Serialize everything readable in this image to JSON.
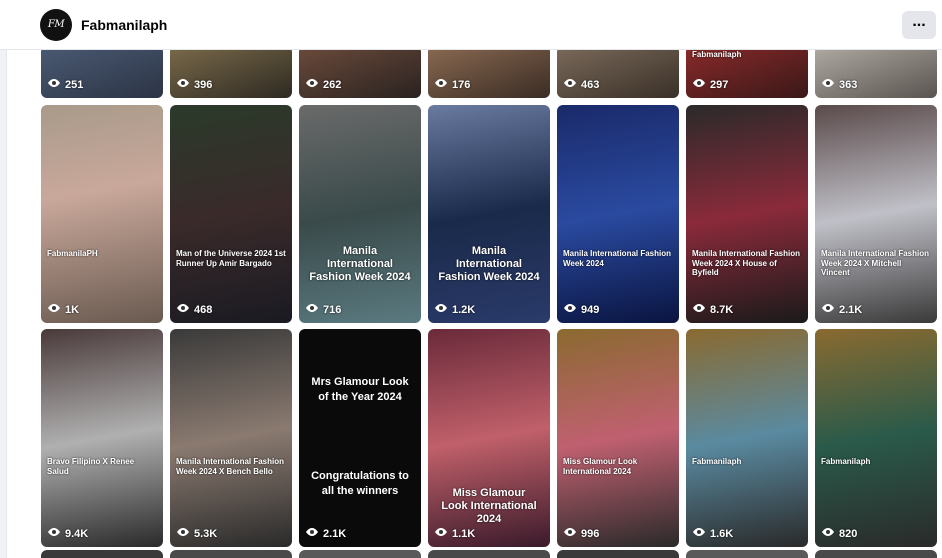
{
  "header": {
    "page_name": "Fabmanilaph",
    "avatar_text": "FM",
    "more_label": "..."
  },
  "rows": [
    [
      {
        "views": "251",
        "bg": "linear-gradient(160deg,#4a5a73,#2c3445)"
      },
      {
        "views": "396",
        "bg": "linear-gradient(160deg,#7a6a4a,#2e2a22)"
      },
      {
        "views": "262",
        "bg": "linear-gradient(160deg,#6b4b3b,#2a2220)"
      },
      {
        "views": "176",
        "bg": "linear-gradient(160deg,#8a6a52,#3a2c24)"
      },
      {
        "views": "463",
        "bg": "linear-gradient(160deg,#7a6a5a,#3a3028)"
      },
      {
        "views": "297",
        "caption": "Fabmanilaph",
        "bg": "linear-gradient(160deg,#8a2a2a,#3a1818)"
      },
      {
        "views": "363",
        "bg": "linear-gradient(160deg,#b0aaa4,#5a5450)"
      }
    ],
    [
      {
        "views": "1K",
        "caption": "FabmanilaPH",
        "bg": "linear-gradient(170deg,#a89a8a,#c9a89b 40%,#6a5a50)"
      },
      {
        "views": "468",
        "caption": "Man of the Universe 2024 1st Runner Up Amir Bargado",
        "bg": "linear-gradient(170deg,#2a3a2a,#3a2a2a 50%,#1a1a22)"
      },
      {
        "views": "716",
        "caption": "Manila International Fashion Week 2024",
        "big": true,
        "bg": "linear-gradient(170deg,#6a6a6a,#3a4a4a 50%,#5a7a80)"
      },
      {
        "views": "1.2K",
        "caption": "Manila International Fashion Week 2024",
        "big": true,
        "bg": "linear-gradient(170deg,#6a7aa0,#1a2a4a 50%,#2a3a6a)"
      },
      {
        "views": "949",
        "caption": "Manila International Fashion Week 2024",
        "bg": "linear-gradient(170deg,#1a2a6a,#2a4aa0 50%,#0a1440)"
      },
      {
        "views": "8.7K",
        "caption": "Manila International Fashion Week 2024 X House of Byfield",
        "bg": "linear-gradient(170deg,#2a2a2a,#8a2a3a 50%,#1a1a1a)"
      },
      {
        "views": "2.1K",
        "caption": "Manila International Fashion Week 2024 X Mitchell Vincent",
        "bg": "linear-gradient(170deg,#5a4a4a,#c0c0c8 50%,#3a3a3a)"
      }
    ],
    [
      {
        "views": "9.4K",
        "caption": "Bravo Filipino X Renee Salud",
        "bg": "linear-gradient(170deg,#4a3a3a,#b0b0b0 50%,#2a2a2a)"
      },
      {
        "views": "5.3K",
        "caption": "Manila International Fashion Week 2024 X Bench Bello",
        "bg": "linear-gradient(170deg,#3a3a3a,#8a7a70 50%,#2a2a2a)"
      },
      {
        "views": "2.1K",
        "title_top": "Mrs Glamour Look of the Year 2024",
        "title_mid": "Congratulations to all the winners",
        "bg": "#0a0a0a"
      },
      {
        "views": "1.1K",
        "caption": "Miss Glamour Look International 2024",
        "big": true,
        "bg": "linear-gradient(170deg,#6a2a3a,#c0606a 50%,#3a1a2a)"
      },
      {
        "views": "996",
        "caption": "Miss Glamour Look International 2024",
        "bg": "linear-gradient(170deg,#8a6a30,#c06070 50%,#2a2a2a)"
      },
      {
        "views": "1.6K",
        "caption": "Fabmanilaph",
        "bg": "linear-gradient(170deg,#8a6a30,#5a8aa0 50%,#2a2a2a)"
      },
      {
        "views": "820",
        "caption": "Fabmanilaph",
        "bg": "linear-gradient(170deg,#8a6a30,#2a5a4a 50%,#2a2a2a)"
      }
    ]
  ]
}
